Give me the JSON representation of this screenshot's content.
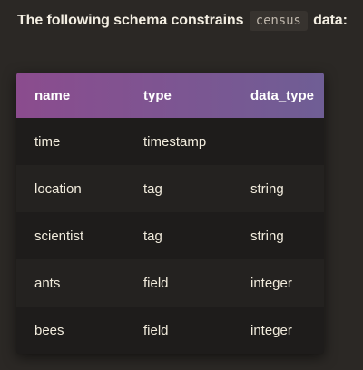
{
  "intro": {
    "before": "The following schema constrains",
    "code": "census",
    "after": "data:"
  },
  "table": {
    "headers": [
      "name",
      "type",
      "data_type"
    ],
    "rows": [
      [
        "time",
        "timestamp",
        ""
      ],
      [
        "location",
        "tag",
        "string"
      ],
      [
        "scientist",
        "tag",
        "string"
      ],
      [
        "ants",
        "field",
        "integer"
      ],
      [
        "bees",
        "field",
        "integer"
      ]
    ]
  },
  "colors": {
    "background": "#2b2825",
    "header_gradient_start": "#8b4c8e",
    "header_gradient_end": "#6f5e95",
    "text": "#f4efe3"
  }
}
